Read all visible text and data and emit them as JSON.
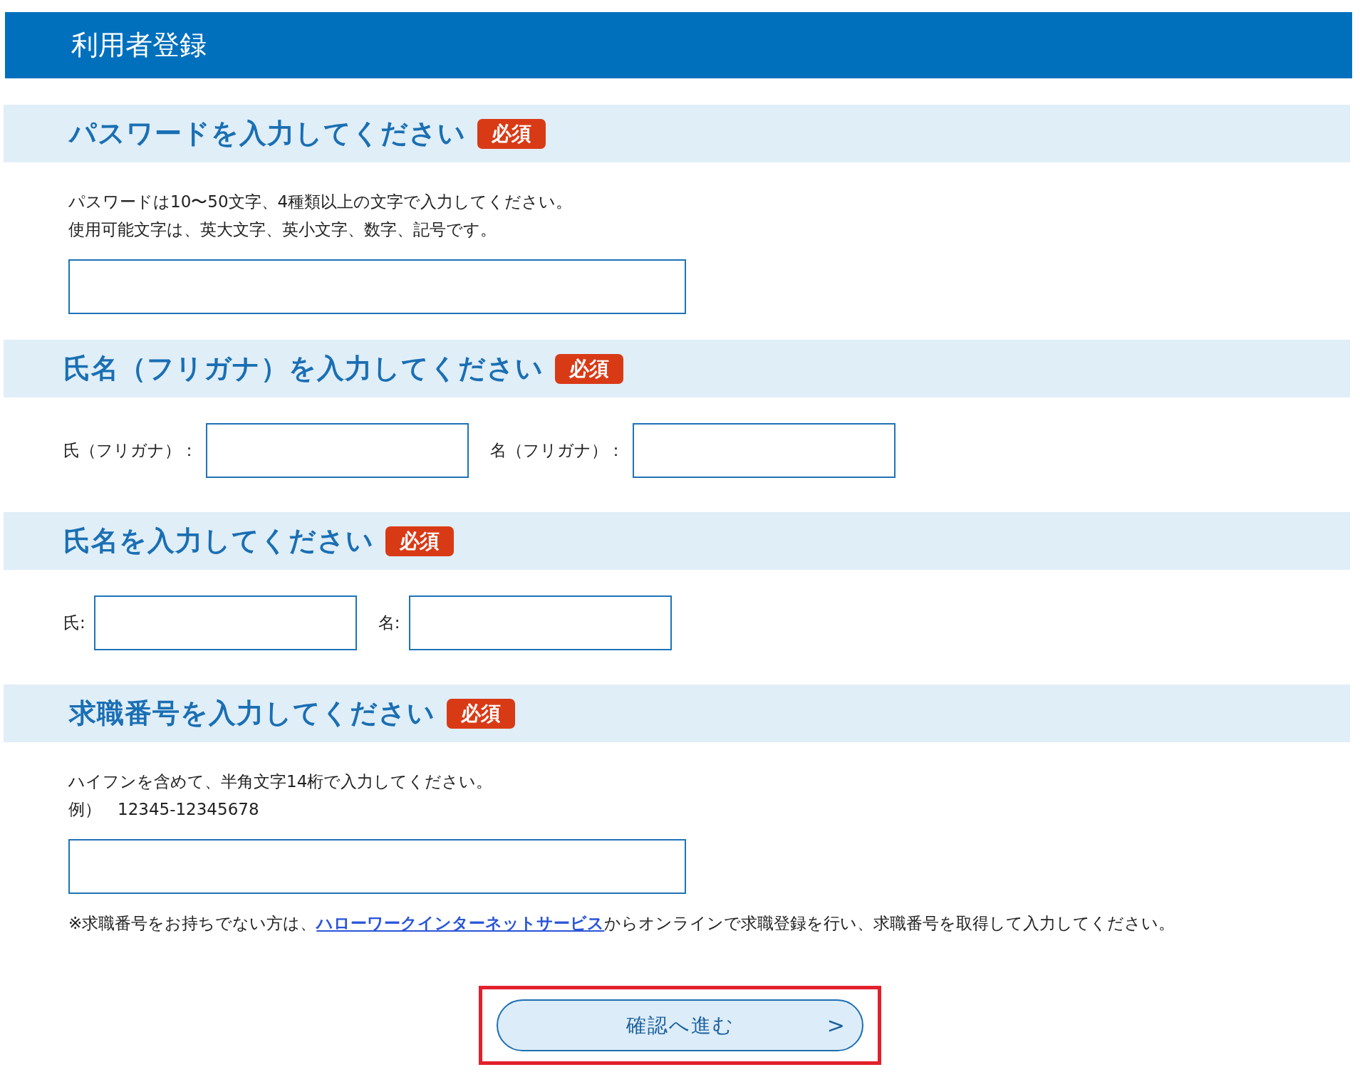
{
  "header": {
    "title": "利用者登録"
  },
  "sections": [
    {
      "kind": "single",
      "heading": "パスワードを入力してください",
      "badge": "必須",
      "notes": [
        "パスワードは10〜50文字、4種類以上の文字で入力してください。",
        "使用可能文字は、英大文字、英小文字、数字、記号です。"
      ]
    },
    {
      "kind": "pair",
      "heading": "氏名（フリガナ）を入力してください",
      "badge": "必須",
      "fields": [
        {
          "label": "氏（フリガナ）："
        },
        {
          "label": "名（フリガナ）："
        }
      ]
    },
    {
      "kind": "pair",
      "heading": "氏名を入力してください",
      "badge": "必須",
      "fields": [
        {
          "label": "氏:"
        },
        {
          "label": "名:"
        }
      ]
    },
    {
      "kind": "single",
      "heading": "求職番号を入力してください",
      "badge": "必須",
      "notes": [
        "ハイフンを含めて、半角文字14桁で入力してください。",
        "例）　12345-12345678"
      ],
      "footnote": {
        "before": "※求職番号をお持ちでない方は、",
        "link": "ハローワークインターネットサービス",
        "after": "からオンラインで求職登録を行い、求職番号を取得して入力してください。"
      }
    }
  ],
  "button": {
    "label": "確認へ進む",
    "arrow": ">",
    "highlighted": true
  }
}
